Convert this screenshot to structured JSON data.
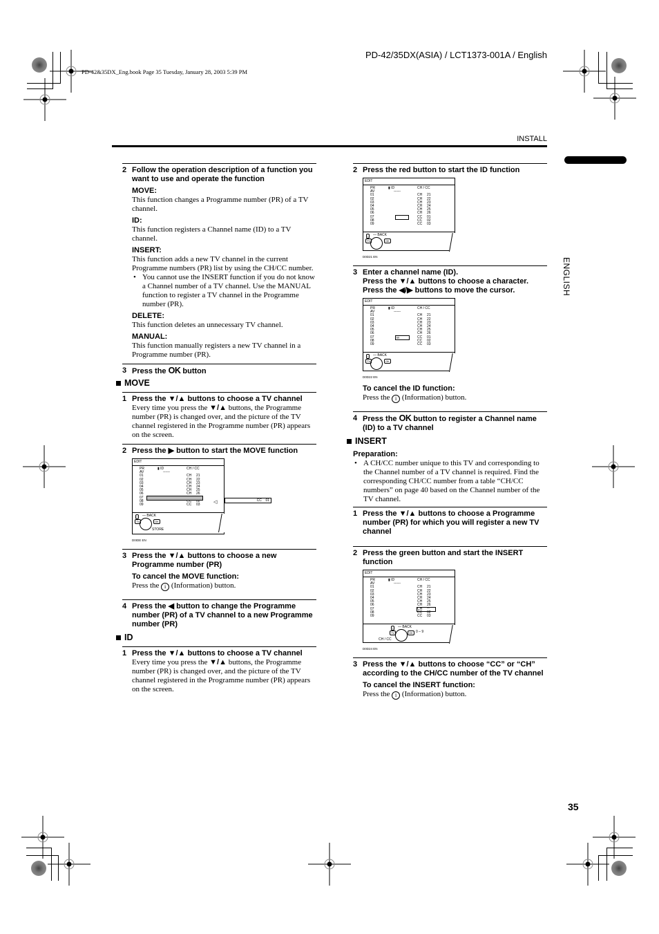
{
  "print_meta": "PD-42&35DX_Eng.book  Page 35  Tuesday, January 28, 2003  5:39 PM",
  "doc_id": "PD-42/35DX(ASIA) / LCT1373-001A / English",
  "section": "INSTALL",
  "language_tab": "ENGLISH",
  "page_number": "35",
  "glyphs": {
    "ok": "OK",
    "down_up": "▼/▲",
    "right": "▶",
    "left": "◀",
    "left_right": "◀/▶",
    "info": "i",
    "bullet": "•"
  },
  "left": {
    "step2": {
      "num": "2",
      "title": "Follow the operation description of a function you want to use and operate the function",
      "functions": [
        {
          "name": "MOVE:",
          "desc": "This function changes a Programme number (PR) of a TV channel."
        },
        {
          "name": "ID:",
          "desc": "This function registers a Channel name (ID) to a TV channel."
        },
        {
          "name": "INSERT:",
          "desc": "This function adds a new TV channel in the current Programme numbers (PR) list by using the CH/CC number.",
          "bullet": "You cannot use the INSERT function if you do not know a Channel number of a TV channel. Use the MANUAL function to register a TV channel in the Programme number (PR)."
        },
        {
          "name": "DELETE:",
          "desc": "This function deletes an unnecessary TV channel."
        },
        {
          "name": "MANUAL:",
          "desc": "This function manually registers a new TV channel in a Programme number (PR)."
        }
      ]
    },
    "step3": {
      "num": "3",
      "pre": "Press the",
      "post": "button"
    },
    "move": {
      "heading": "MOVE",
      "s1": {
        "num": "1",
        "pre": "Press the",
        "post": "buttons to choose a TV channel",
        "body_pre": "Every time you press the",
        "body_post": "buttons, the Programme number (PR) is changed over, and the picture of the TV channel registered in the Programme number (PR) appears on the screen."
      },
      "s2": {
        "num": "2",
        "pre": "Press the",
        "post": "button to start the MOVE function"
      },
      "s3": {
        "num": "3",
        "pre": "Press the",
        "post": "buttons to choose a new Programme number (PR)",
        "cancel_title": "To cancel the MOVE function:",
        "cancel_pre": "Press the",
        "cancel_post": "(Information) button."
      },
      "s4": {
        "num": "4",
        "pre": "Press the",
        "post": "button to change the Programme number (PR) of a TV channel to a new Programme number (PR)"
      }
    },
    "id": {
      "heading": "ID",
      "s1": {
        "num": "1",
        "pre": "Press the",
        "post": "buttons to choose a TV channel",
        "body_pre": "Every time you press the",
        "body_post": "buttons, the Programme number (PR) is changed over, and the picture of the TV channel registered in the Programme number (PR) appears on the screen."
      }
    }
  },
  "right": {
    "id_s2": {
      "num": "2",
      "title": "Press the red button to start the ID function"
    },
    "id_s3": {
      "num": "3",
      "line1": "Enter a channel name (ID).",
      "line2_pre": "Press the",
      "line2_post": "buttons to choose a character.",
      "line3_pre": "Press the",
      "line3_post": "buttons to move the cursor.",
      "cancel_title": "To cancel the ID function:",
      "cancel_pre": "Press the",
      "cancel_post": "(Information) button."
    },
    "id_s4": {
      "num": "4",
      "pre": "Press the",
      "post": "button to register a Channel name (ID) to a TV channel"
    },
    "insert": {
      "heading": "INSERT",
      "prep_title": "Preparation:",
      "prep_bullet": "A CH/CC number unique to this TV and corresponding to the Channel number of a TV channel is required. Find the corresponding CH/CC number from a table “CH/CC numbers” on page 40 based on the Channel number of the TV channel.",
      "s1": {
        "num": "1",
        "pre": "Press the",
        "post": "buttons to choose a Programme number (PR) for which you will register a new TV channel"
      },
      "s2": {
        "num": "2",
        "title": "Press the green button and start the INSERT function"
      },
      "s3": {
        "num": "3",
        "pre": "Press the",
        "post": "buttons to choose “CC” or “CH” according to the CH/CC number of the TV channel",
        "cancel_title": "To cancel the INSERT function:",
        "cancel_pre": "Press the",
        "cancel_post": "(Information) button."
      }
    }
  },
  "osd": {
    "title": "EDIT",
    "col_pr": "PR",
    "col_id": "ID",
    "col_chcc": "CH / CC",
    "av": "AV",
    "id_placeholder": "------",
    "rows": [
      {
        "pr": "01",
        "ch": "CH",
        "num": "21"
      },
      {
        "pr": "02",
        "ch": "CH",
        "num": "22"
      },
      {
        "pr": "03",
        "ch": "CH",
        "num": "23"
      },
      {
        "pr": "04",
        "ch": "CH",
        "num": "24"
      },
      {
        "pr": "05",
        "ch": "CH",
        "num": "25"
      },
      {
        "pr": "06",
        "ch": "CH",
        "num": "26"
      },
      {
        "pr": "07",
        "ch": "CC",
        "num": "01"
      },
      {
        "pr": "08",
        "ch": "CC",
        "num": "02"
      },
      {
        "pr": "09",
        "ch": "CC",
        "num": "03"
      }
    ],
    "back": "BACK",
    "store": "STORE",
    "tv_key": "TV",
    "ok_key": "OK",
    "info_key": "i",
    "chcc_label": "CH / CC",
    "range_label": "0 – 9",
    "move_popup": {
      "ch": "CC",
      "num": "01"
    },
    "id_cursor_char": "M",
    "insert_row": {
      "ch": "CH",
      "num": "**"
    },
    "codes": [
      "D0IDE EN",
      "D0D21 EN",
      "D0D22 EN",
      "D0D24 EN"
    ]
  }
}
